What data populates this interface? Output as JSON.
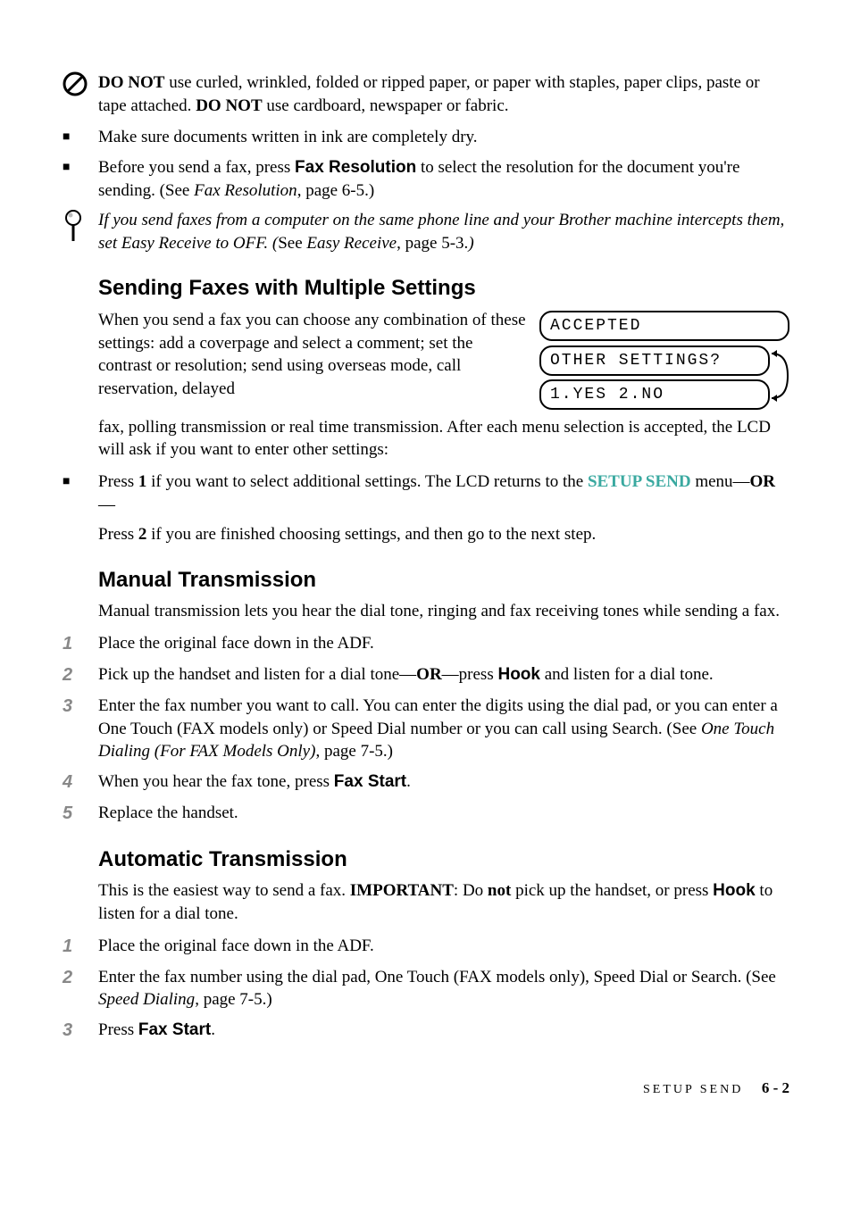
{
  "warn": {
    "text_before1": "DO NOT",
    "text1": " use curled, wrinkled, folded or ripped paper, or paper with staples, paper clips, paste or tape attached. ",
    "text_before2": "DO NOT",
    "text2": " use cardboard, newspaper or fabric."
  },
  "bullets": {
    "a": "Make sure documents written in ink are completely dry.",
    "b_before": "Before you send a fax, press ",
    "b_bold": "Fax Resolution",
    "b_mid": " to select the resolution for the document you're sending. (See ",
    "b_italic": "Fax Resolution",
    "b_after": ", page 6-5.)"
  },
  "note": {
    "line1": "If you send faxes from a computer on the same phone line and your Brother machine intercepts them, set Easy Receive to OFF. (",
    "see": "See ",
    "ref": "Easy Receive",
    "tail": ", page 5-3.",
    "close": ")"
  },
  "sec1": {
    "heading": "Sending Faxes with Multiple Settings",
    "p1a": "When you send a fax you can choose any combination of these settings:  add a coverpage and select a comment; set the contrast or resolution; send using overseas mode, call reservation, delayed ",
    "p1b": "fax, polling transmission or real time transmission. After each menu selection is accepted, the LCD will ask if you want to enter other settings:",
    "lcd": {
      "a": "ACCEPTED",
      "b": "OTHER SETTINGS?",
      "c": "1.YES 2.NO"
    },
    "b1_pre": "Press ",
    "b1_one": "1",
    "b1_mid": " if you want to select additional settings. The LCD returns to the ",
    "b1_teal": "SETUP SEND",
    "b1_menu": " menu—",
    "b1_or": "OR",
    "b1_dash": "—",
    "b2_pre": "Press ",
    "b2_two": "2",
    "b2_after": " if you are finished choosing settings, and then go to the next step."
  },
  "sec2": {
    "heading": "Manual Transmission",
    "intro": "Manual transmission lets you hear the dial tone, ringing and fax receiving tones while sending a fax.",
    "s1": "Place the original face down in the ADF.",
    "s2_a": "Pick up the handset and listen for a dial tone—",
    "s2_or": "OR",
    "s2_b": "—press ",
    "s2_hook": "Hook",
    "s2_c": " and listen for a dial tone.",
    "s3_a": "Enter the fax number you want to call. You can enter the digits using the dial pad, or you can enter a One Touch (FAX models only) or Speed Dial number or you can call using Search. (See ",
    "s3_i": "One Touch Dialing (For FAX Models Only)",
    "s3_b": ", page 7-5.)",
    "s4_a": "When you hear the fax tone, press ",
    "s4_b": "Fax Start",
    "s4_c": ".",
    "s5": "Replace the handset."
  },
  "sec3": {
    "heading": "Automatic Transmission",
    "p_a": "This is the easiest way to send a fax. ",
    "p_imp": "IMPORTANT",
    "p_b": ": Do ",
    "p_not": "not",
    "p_c": " pick up the handset, or press ",
    "p_hook": "Hook",
    "p_d": " to listen for a dial tone.",
    "s1": "Place the original face down in the ADF.",
    "s2_a": "Enter the fax number using the dial pad, One Touch (FAX models only), Speed Dial or Search. (See ",
    "s2_i": "Speed Dialing",
    "s2_b": ", page 7-5.)",
    "s3_a": "Press ",
    "s3_b": "Fax Start",
    "s3_c": "."
  },
  "footer": {
    "section": "SETUP SEND",
    "page": "6 - 2"
  },
  "nums": {
    "n1": "1",
    "n2": "2",
    "n3": "3",
    "n4": "4",
    "n5": "5"
  },
  "square": "■"
}
